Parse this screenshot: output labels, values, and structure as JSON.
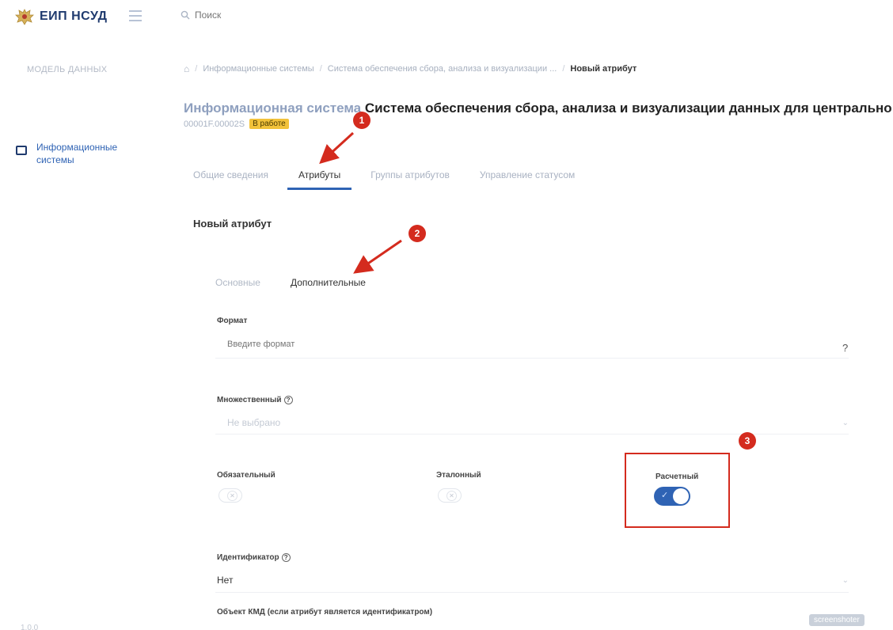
{
  "app": {
    "title": "ЕИП НСУД",
    "logo_icon": "emblem-icon"
  },
  "search": {
    "placeholder": "Поиск"
  },
  "sidebar": {
    "caption": "МОДЕЛЬ ДАННЫХ",
    "items": [
      {
        "label": "Информационные системы",
        "icon": "window-icon"
      }
    ],
    "footer": "1.0.0"
  },
  "breadcrumb": {
    "items": [
      "Информационные системы",
      "Система обеспечения сбора, анализа и визуализации ..."
    ],
    "current": "Новый атрибут"
  },
  "page": {
    "title_prefix": "Информационная система",
    "title_name": "Система обеспечения сбора, анализа и визуализации данных для центрально",
    "code": "00001F.00002S",
    "status": "В работе"
  },
  "tabs": [
    {
      "label": "Общие сведения"
    },
    {
      "label": "Атрибуты",
      "active": true
    },
    {
      "label": "Группы атрибутов"
    },
    {
      "label": "Управление статусом"
    }
  ],
  "section_title": "Новый атрибут",
  "subtabs": [
    {
      "label": "Основные"
    },
    {
      "label": "Дополнительные",
      "active": true
    }
  ],
  "form": {
    "format_label": "Формат",
    "format_placeholder": "Введите формат",
    "format_help": "?",
    "multiple_label": "Множественный",
    "multiple_value": "Не выбрано",
    "required_label": "Обязательный",
    "required_value": false,
    "reference_label": "Эталонный",
    "reference_value": false,
    "calculated_label": "Расчетный",
    "calculated_value": true,
    "identifier_label": "Идентификатор",
    "identifier_value": "Нет",
    "kmd_object_label": "Объект КМД (если атрибут является идентификатром)"
  },
  "annotations": {
    "markers": [
      "1",
      "2",
      "3"
    ],
    "color": "#d42b1e"
  },
  "watermark": "screenshoter",
  "colors": {
    "accent": "#2f63b4",
    "status_badge": "#f2c23a",
    "annotation": "#d42b1e"
  }
}
